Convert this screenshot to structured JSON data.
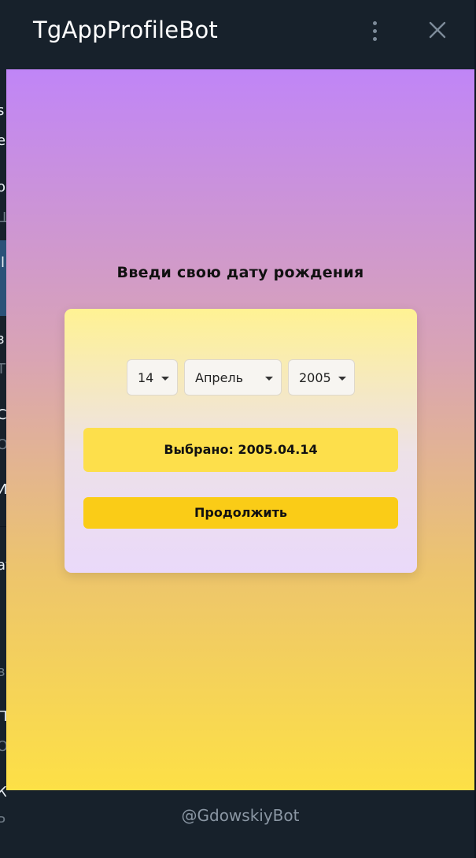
{
  "window": {
    "title": "TgAppProfileBot",
    "footer_username": "@GdowskiyBot"
  },
  "background_chat_list": {
    "fragments": [
      "s",
      "e",
      "o",
      "Ш",
      "il",
      "з",
      "Т",
      "С",
      "О",
      "И",
      "at",
      "в",
      "П",
      "О",
      "К",
      "Р"
    ]
  },
  "form": {
    "heading": "Введи свою дату рождения",
    "day": "14",
    "month": "Апрель",
    "year": "2005",
    "selected_text": "Выбрано: 2005.04.14",
    "continue_label": "Продолжить"
  },
  "colors": {
    "gradient_top": "#c085f7",
    "gradient_bottom": "#fde046",
    "button_yellow": "#facc17",
    "selected_yellow": "#fddf4b",
    "window_dark": "#17212b"
  }
}
